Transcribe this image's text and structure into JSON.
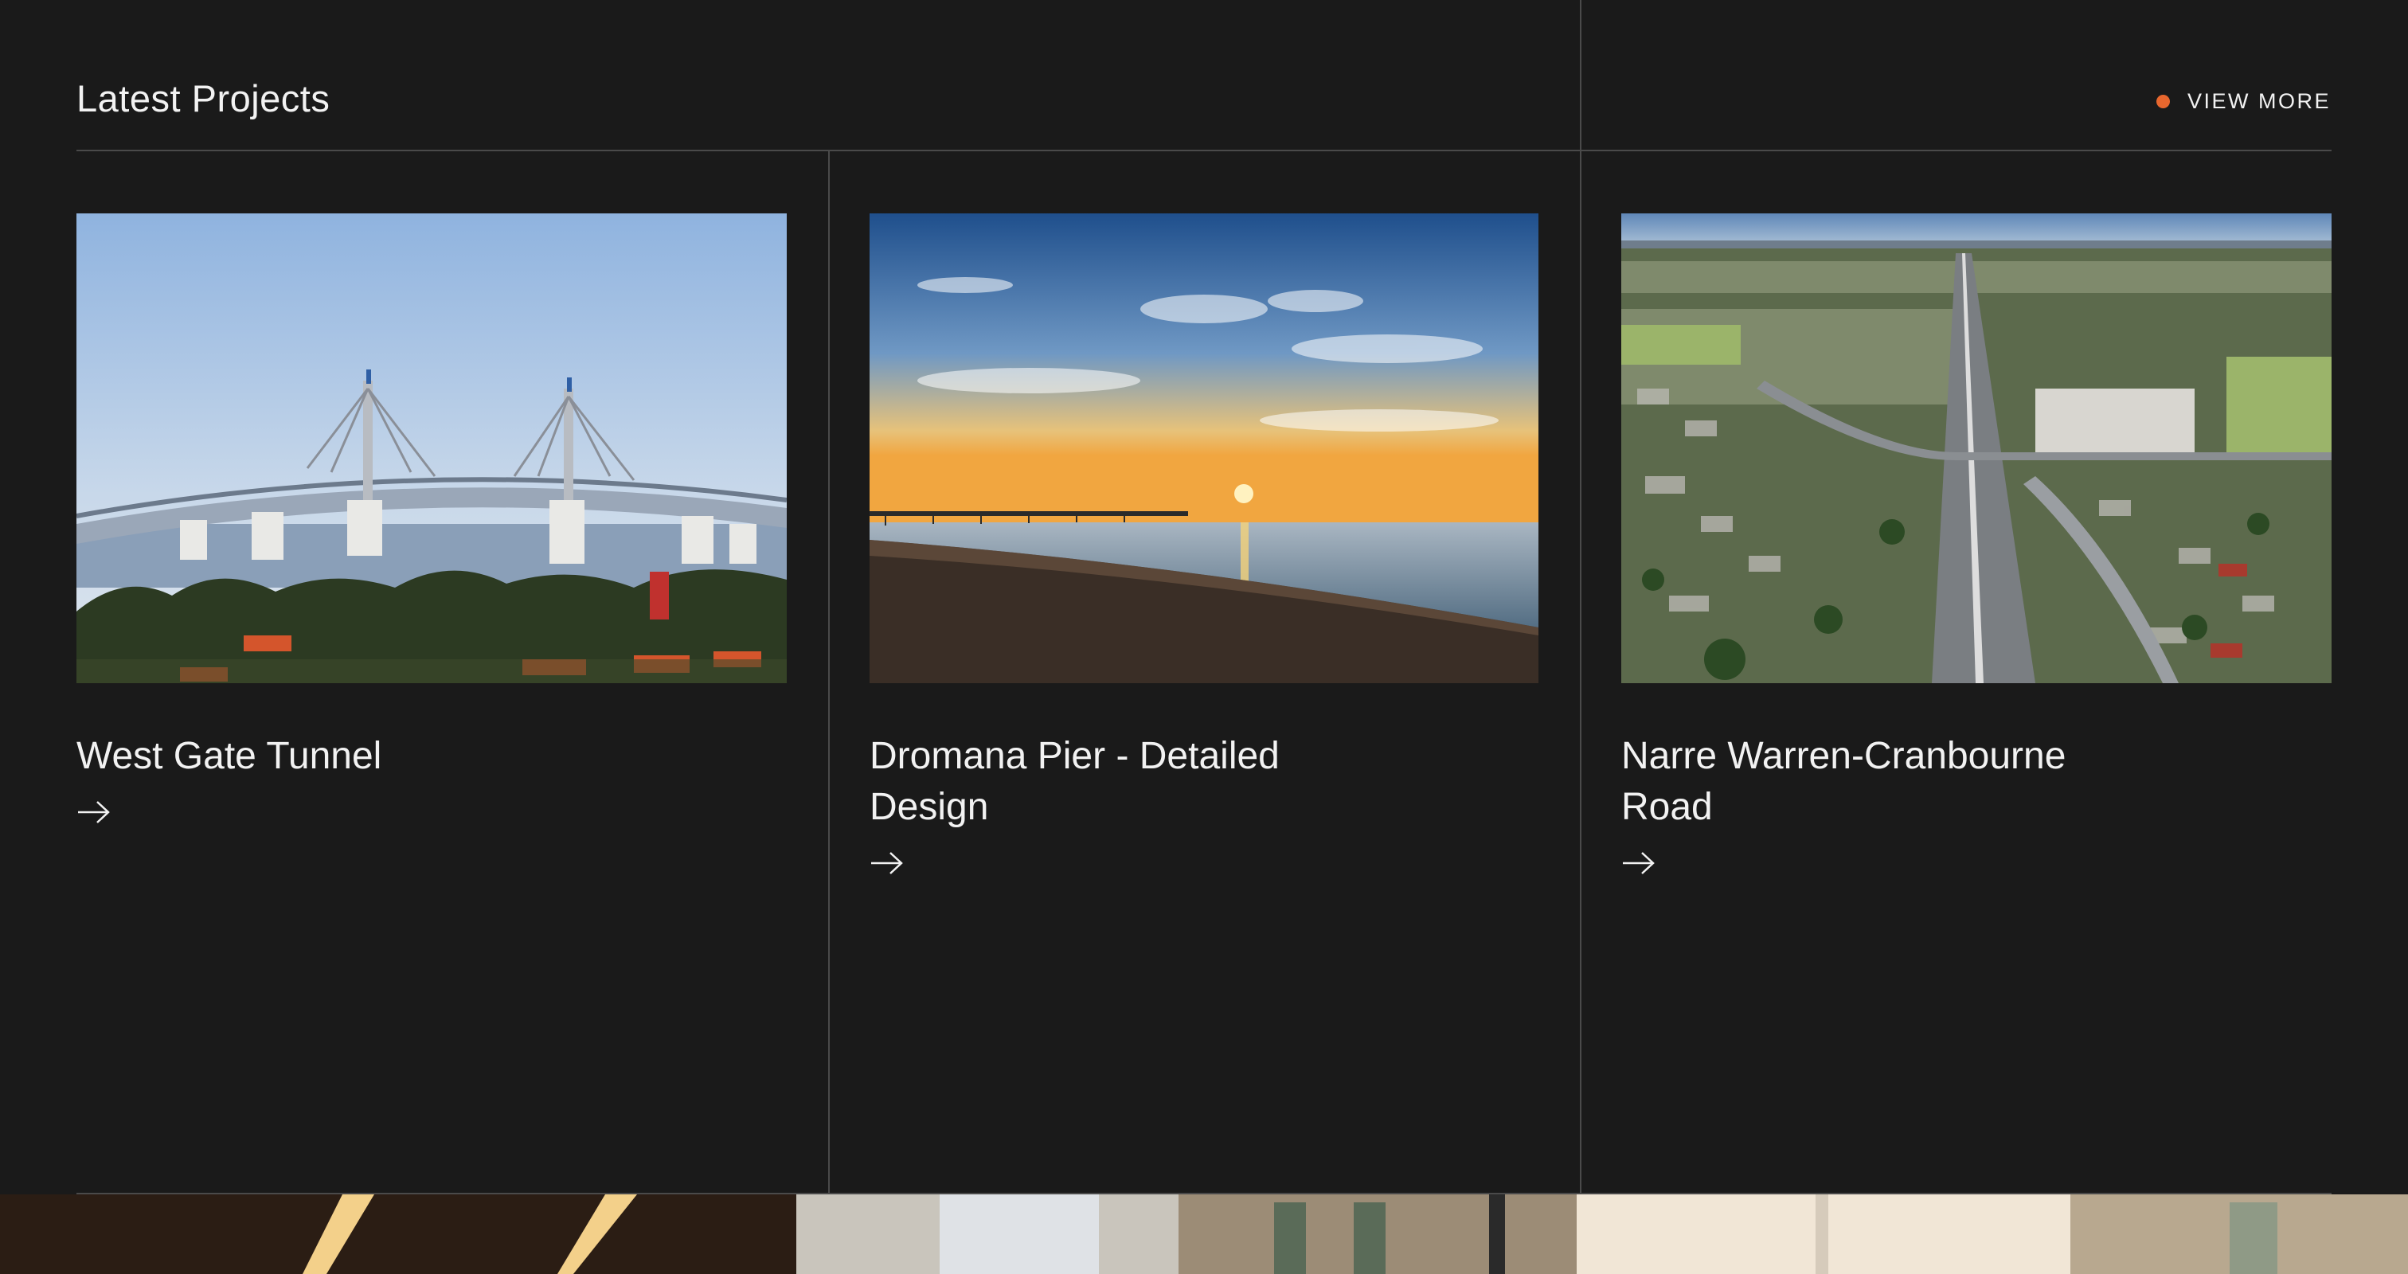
{
  "header": {
    "title": "Latest Projects",
    "view_more_label": "VIEW MORE",
    "accent_color": "#e8672e"
  },
  "projects": [
    {
      "name": "West Gate Tunnel",
      "image_subject": "cable-stayed bridge over bay with trees and red rooftops",
      "arrow_icon": "arrow-right-icon"
    },
    {
      "name": "Dromana Pier - Detailed Design",
      "image_subject": "long pier at sunset over calm bay and sandy beach",
      "arrow_icon": "arrow-right-icon"
    },
    {
      "name": "Narre Warren-Cranbourne Road",
      "image_subject": "aerial view of divided road through suburbs",
      "arrow_icon": "arrow-right-icon"
    }
  ]
}
